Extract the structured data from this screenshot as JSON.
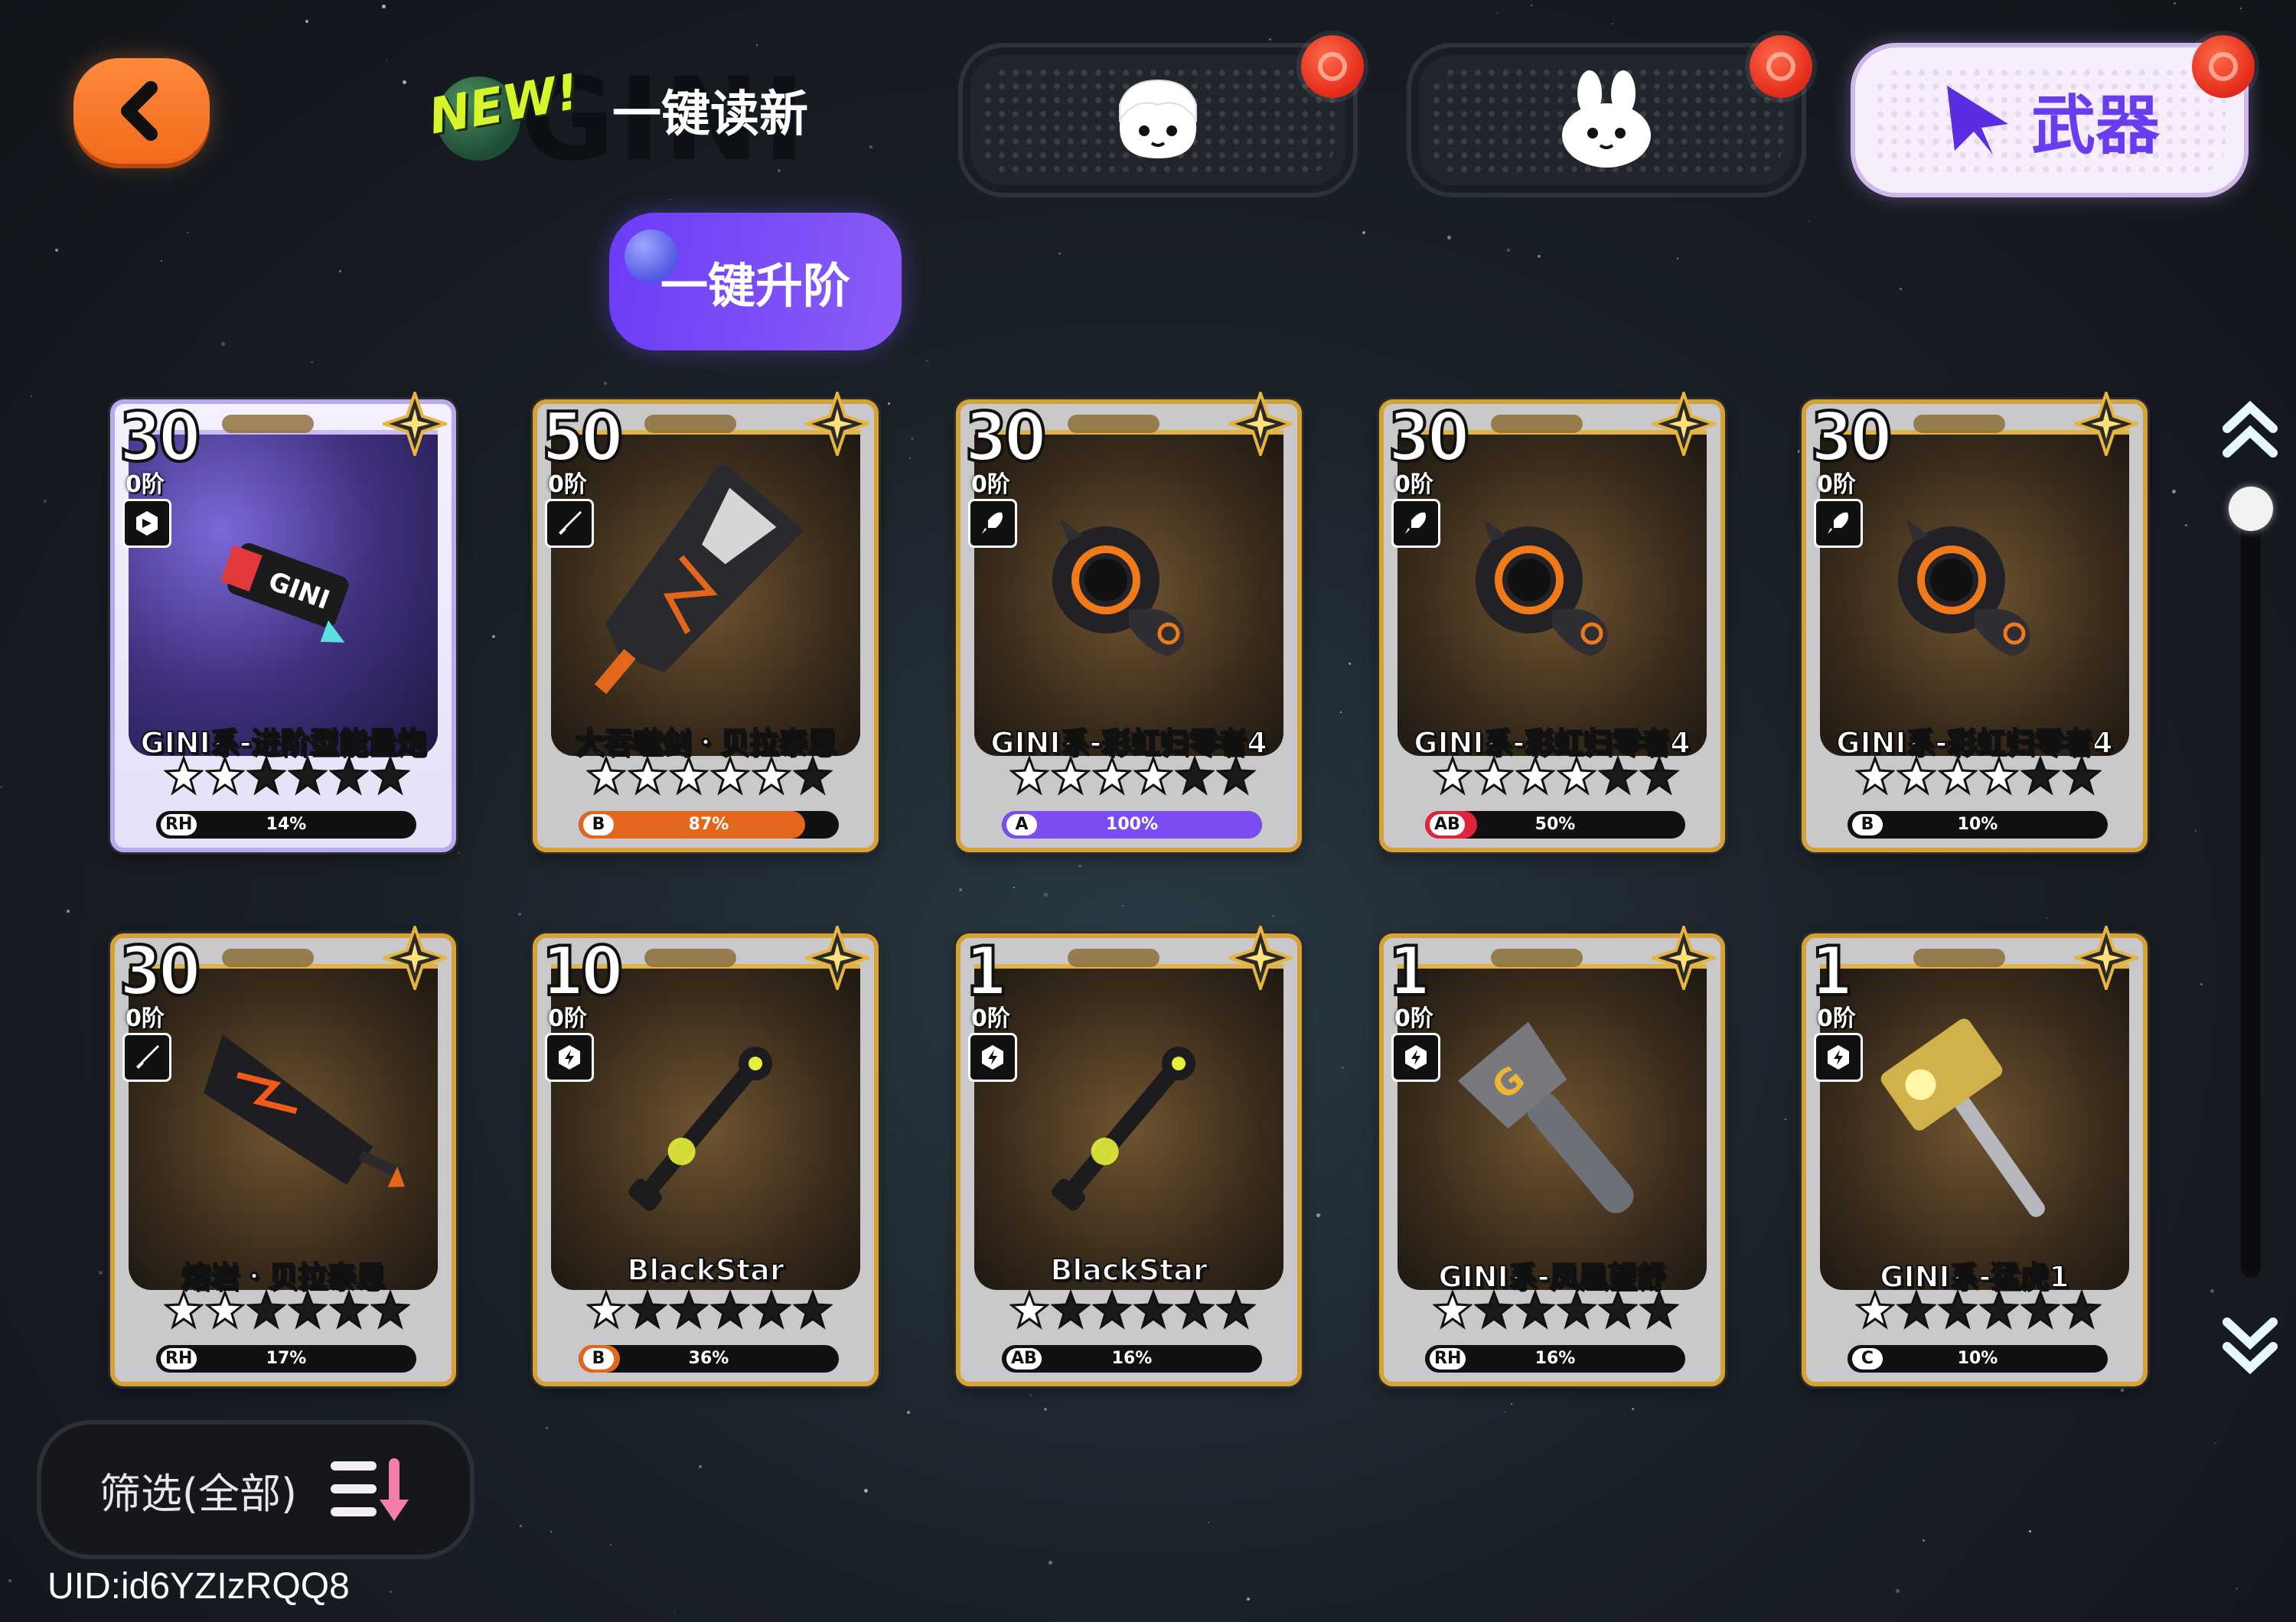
{
  "header": {
    "new_tag": "NEW!",
    "new_label": "一键读新",
    "upgrade_label": "一键升阶",
    "weapon_tab_label": "武器"
  },
  "cards": [
    {
      "level": "30",
      "rank": "0阶",
      "name": "GINI系-进阶型能量炮",
      "stars": 2,
      "grade": "RH",
      "pct": "14%",
      "fill": 0.14,
      "fill_color": "#111111",
      "type": "cannon",
      "art": "cannon",
      "special": true
    },
    {
      "level": "50",
      "rank": "0阶",
      "name": "大吞噬剑・贝拉泰恩",
      "stars": 5,
      "grade": "B",
      "pct": "87%",
      "fill": 0.87,
      "fill_color": "#e2661b",
      "type": "sword",
      "art": "greatsword",
      "special": false
    },
    {
      "level": "30",
      "rank": "0阶",
      "name": "GINI系-彩虹归零者4",
      "stars": 4,
      "grade": "A",
      "pct": "100%",
      "fill": 1.0,
      "fill_color": "#7b4cf0",
      "type": "rocket",
      "art": "ring",
      "special": false
    },
    {
      "level": "30",
      "rank": "0阶",
      "name": "GINI系-彩虹归零者4",
      "stars": 4,
      "grade": "AB",
      "pct": "50%",
      "fill": 0.2,
      "fill_color": "#e0233a",
      "type": "rocket",
      "art": "ring",
      "special": false
    },
    {
      "level": "30",
      "rank": "0阶",
      "name": "GINI系-彩虹归零者4",
      "stars": 4,
      "grade": "B",
      "pct": "10%",
      "fill": 0.1,
      "fill_color": "#111111",
      "type": "rocket",
      "art": "ring",
      "special": false
    },
    {
      "level": "30",
      "rank": "0阶",
      "name": "熔岩・贝拉泰恩",
      "stars": 2,
      "grade": "RH",
      "pct": "17%",
      "fill": 0.17,
      "fill_color": "#111111",
      "type": "sword",
      "art": "lavasword",
      "special": false
    },
    {
      "level": "10",
      "rank": "0阶",
      "name": "BlackStar",
      "stars": 1,
      "grade": "B",
      "pct": "36%",
      "fill": 0.16,
      "fill_color": "#e2661b",
      "type": "shield",
      "art": "staff",
      "special": false
    },
    {
      "level": "1",
      "rank": "0阶",
      "name": "BlackStar",
      "stars": 1,
      "grade": "AB",
      "pct": "16%",
      "fill": 0.16,
      "fill_color": "#111111",
      "type": "shield",
      "art": "staff",
      "special": false
    },
    {
      "level": "1",
      "rank": "0阶",
      "name": "GINI系-凤凰望舒",
      "stars": 1,
      "grade": "RH",
      "pct": "16%",
      "fill": 0.16,
      "fill_color": "#111111",
      "type": "shield",
      "art": "wrench",
      "special": false
    },
    {
      "level": "1",
      "rank": "0阶",
      "name": "GINI系-猛虎1",
      "stars": 1,
      "grade": "C",
      "pct": "10%",
      "fill": 0.1,
      "fill_color": "#111111",
      "type": "shield",
      "art": "hammer",
      "special": false
    }
  ],
  "filter": {
    "label": "筛选(全部)"
  },
  "uid": "UID:id6YZIzRQQ8"
}
